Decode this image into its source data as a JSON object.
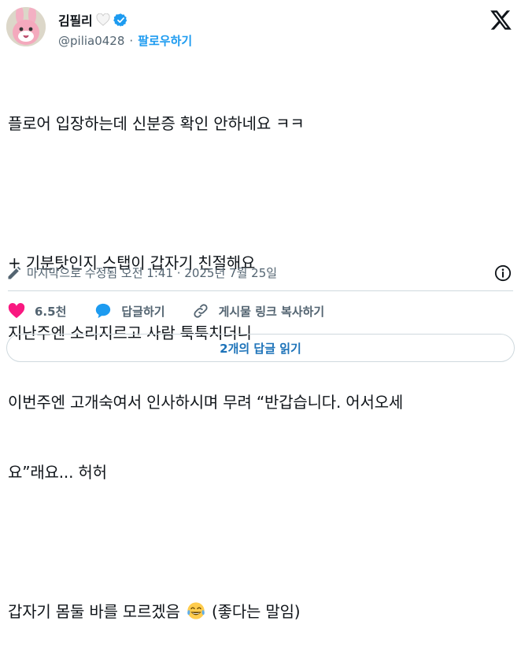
{
  "header": {
    "display_name": "김필리",
    "name_emoji": "white-heart",
    "handle": "@pilia0428",
    "separator": "·",
    "follow_label": "팔로우하기"
  },
  "tweet": {
    "lines": [
      "플로어 입장하는데 신분증 확인 안하네요 ㅋㅋ",
      "",
      "+ 기분탓인지 스탭이 갑자기 친절해요",
      "지난주엔 소리지르고 사람 툭툭치더니",
      "이번주엔 고개숙여서 인사하시며 무려 “반갑습니다. 어서오세",
      "요”래요... 허허",
      "",
      "갑자기 몸둘 바를 모르겠음",
      "(좋다는 말임)"
    ],
    "inline_emoji": "face-with-tears-of-joy"
  },
  "meta": {
    "text": "마지막으로 수정됨 오전 1:41 · 2025년 7월 25일"
  },
  "actions": {
    "like_count": "6.5천",
    "reply_label": "답글하기",
    "copy_link_label": "게시물 링크 복사하기"
  },
  "read_replies_label": "2개의 답글 읽기",
  "colors": {
    "accent": "#1d9bf0",
    "like": "#f91880",
    "reply": "#1d9bf0",
    "secondary_text": "#536471",
    "border": "#cfd9de"
  }
}
